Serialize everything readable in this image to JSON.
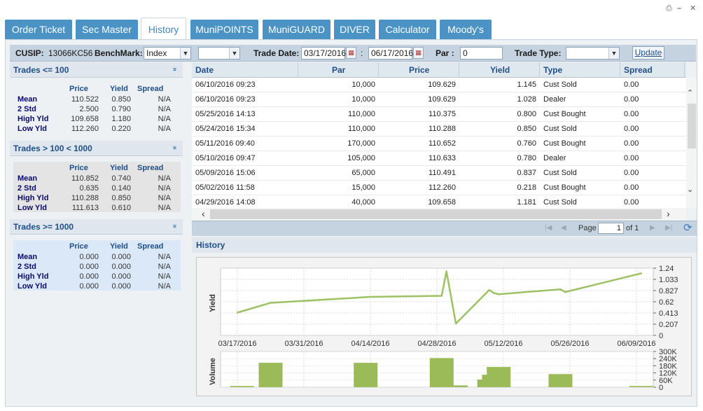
{
  "window_controls": {
    "print_icon": "printer-icon",
    "minimize_label": "–",
    "close_label": "✕"
  },
  "tabs": [
    {
      "label": "Order Ticket",
      "active": false
    },
    {
      "label": "Sec Master",
      "active": false
    },
    {
      "label": "History",
      "active": true
    },
    {
      "label": "MuniPOINTS",
      "active": false
    },
    {
      "label": "MuniGUARD",
      "active": false
    },
    {
      "label": "DIVER",
      "active": false
    },
    {
      "label": "Calculator",
      "active": false
    },
    {
      "label": "Moody's",
      "active": false
    }
  ],
  "filters": {
    "cusip_label": "CUSIP:",
    "cusip_value": "13066KC56",
    "benchmark_label": "BenchMark:",
    "benchmark_value": "Index",
    "second_select_value": "",
    "trade_date_label": "Trade Date:",
    "date_from": "03/17/2016",
    "date_sep": ":",
    "date_to": "06/17/2016",
    "par_label": "Par :",
    "par_value": "0",
    "trade_type_label": "Trade Type:",
    "trade_type_value": "",
    "update_label": "Update"
  },
  "stats": {
    "col_price": "Price",
    "col_yield": "Yield",
    "col_spread": "Spread",
    "row_labels": [
      "Mean",
      "2 Std",
      "High Yld",
      "Low Yld"
    ],
    "panels": [
      {
        "title": "Trades <= 100",
        "rows": [
          [
            "110.522",
            "0.850",
            "N/A"
          ],
          [
            "2.500",
            "0.790",
            "N/A"
          ],
          [
            "109.658",
            "1.180",
            "N/A"
          ],
          [
            "112.260",
            "0.220",
            "N/A"
          ]
        ]
      },
      {
        "title": "Trades > 100 < 1000",
        "rows": [
          [
            "110.852",
            "0.740",
            "N/A"
          ],
          [
            "0.635",
            "0.140",
            "N/A"
          ],
          [
            "110.288",
            "0.850",
            "N/A"
          ],
          [
            "111.613",
            "0.610",
            "N/A"
          ]
        ]
      },
      {
        "title": "Trades >= 1000",
        "rows": [
          [
            "0.000",
            "0.000",
            "N/A"
          ],
          [
            "0.000",
            "0.000",
            "N/A"
          ],
          [
            "0.000",
            "0.000",
            "N/A"
          ],
          [
            "0.000",
            "0.000",
            "N/A"
          ]
        ]
      }
    ]
  },
  "grid": {
    "columns": [
      "Date",
      "Par",
      "Price",
      "Yield",
      "Type",
      "Spread"
    ],
    "rows": [
      [
        "06/10/2016 09:23",
        "10,000",
        "109.629",
        "1.145",
        "Cust Sold",
        "0.00"
      ],
      [
        "06/10/2016 09:23",
        "10,000",
        "109.629",
        "1.028",
        "Dealer",
        "0.00"
      ],
      [
        "05/25/2016 14:13",
        "110,000",
        "110.375",
        "0.800",
        "Cust Bought",
        "0.00"
      ],
      [
        "05/24/2016 15:34",
        "110,000",
        "110.288",
        "0.850",
        "Cust Sold",
        "0.00"
      ],
      [
        "05/11/2016 09:40",
        "170,000",
        "110.652",
        "0.760",
        "Cust Bought",
        "0.00"
      ],
      [
        "05/10/2016 09:47",
        "105,000",
        "110.633",
        "0.780",
        "Dealer",
        "0.00"
      ],
      [
        "05/09/2016 15:06",
        "65,000",
        "110.491",
        "0.837",
        "Cust Sold",
        "0.00"
      ],
      [
        "05/02/2016 11:58",
        "15,000",
        "112.260",
        "0.218",
        "Cust Bought",
        "0.00"
      ],
      [
        "04/29/2016 14:08",
        "40,000",
        "109.658",
        "1.181",
        "Cust Sold",
        "0.00"
      ]
    ]
  },
  "pager": {
    "page_label": "Page",
    "page_value": "1",
    "of_label": "of 1"
  },
  "history": {
    "title": "History"
  },
  "chart_data": {
    "type": "line",
    "xlabel": "",
    "x_ticks": [
      "03/17/2016",
      "03/31/2016",
      "04/14/2016",
      "04/28/2016",
      "05/12/2016",
      "05/26/2016",
      "06/09/2016"
    ],
    "yield": {
      "ylabel": "Yield",
      "ylim": [
        0,
        1.24
      ],
      "y_ticks": [
        "1.24",
        "1.033",
        "0.827",
        "0.62",
        "0.413",
        "0.207",
        "0"
      ],
      "x": [
        "03/17/2016",
        "03/24/2016",
        "04/14/2016",
        "04/29/2016",
        "04/30/2016",
        "05/02/2016",
        "05/09/2016",
        "05/10/2016",
        "05/11/2016",
        "05/24/2016",
        "05/25/2016",
        "06/10/2016"
      ],
      "values": [
        0.42,
        0.6,
        0.71,
        0.73,
        1.18,
        0.218,
        0.837,
        0.78,
        0.76,
        0.85,
        0.8,
        1.145
      ],
      "color": "#9dc163"
    },
    "volume": {
      "ylabel": "Volume",
      "ylim": [
        0,
        300000
      ],
      "y_ticks": [
        "300K",
        "240K",
        "180K",
        "120K",
        "60K",
        "0"
      ],
      "bars": [
        {
          "x": "03/18/2016",
          "value": 10000
        },
        {
          "x": "03/24/2016",
          "value": 205000
        },
        {
          "x": "04/13/2016",
          "value": 205000
        },
        {
          "x": "04/29/2016",
          "value": 245000
        },
        {
          "x": "05/02/2016",
          "value": 15000
        },
        {
          "x": "05/09/2016",
          "value": 65000
        },
        {
          "x": "05/10/2016",
          "value": 105000
        },
        {
          "x": "05/11/2016",
          "value": 170000
        },
        {
          "x": "05/24/2016",
          "value": 110000
        },
        {
          "x": "06/10/2016",
          "value": 10000
        }
      ],
      "color": "#9bbb59"
    },
    "grid": true
  }
}
